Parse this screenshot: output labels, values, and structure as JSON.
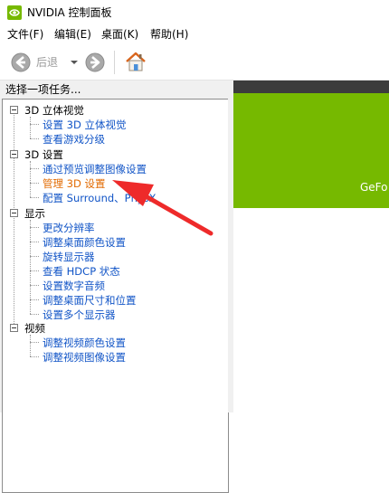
{
  "window": {
    "title": "NVIDIA 控制面板"
  },
  "menu": [
    "文件(F)",
    "编辑(E)",
    "桌面(K)",
    "帮助(H)"
  ],
  "toolbar": {
    "back_label": "后退"
  },
  "tasks": {
    "header": "选择一项任务...",
    "categories": [
      {
        "label": "3D 立体视觉",
        "items": [
          "设置 3D 立体视觉",
          "查看游戏分级"
        ]
      },
      {
        "label": "3D 设置",
        "items": [
          "通过预览调整图像设置",
          "管理 3D 设置",
          "配置 Surround、PhysX"
        ]
      },
      {
        "label": "显示",
        "items": [
          "更改分辨率",
          "调整桌面颜色设置",
          "旋转显示器",
          "查看 HDCP 状态",
          "设置数字音频",
          "调整桌面尺寸和位置",
          "设置多个显示器"
        ]
      },
      {
        "label": "视频",
        "items": [
          "调整视频颜色设置",
          "调整视频图像设置"
        ]
      }
    ],
    "active_item": "管理 3D 设置"
  },
  "banner": {
    "text": "GeFo"
  },
  "colors": {
    "nvidia_green": "#76b900",
    "link": "#1255c7",
    "active_link": "#e26a00",
    "annotation_arrow": "#ee2a2a"
  }
}
